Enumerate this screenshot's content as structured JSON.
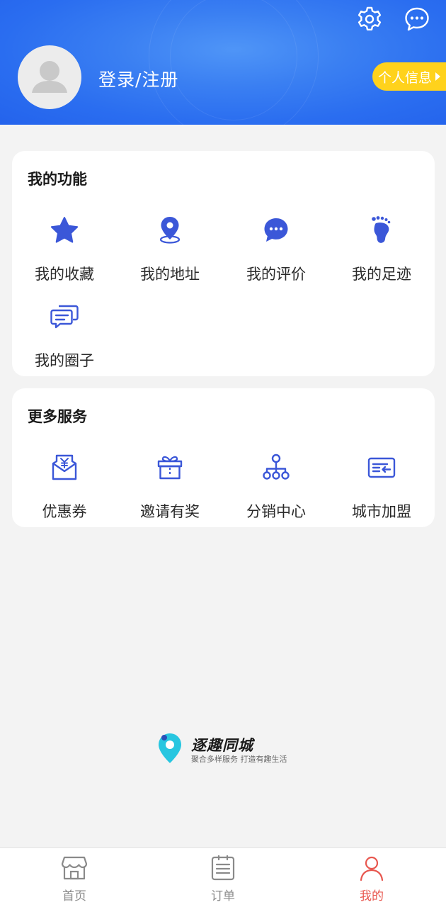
{
  "header": {
    "login_label": "登录/注册",
    "profile_button_label": "个人信息",
    "icons": [
      "settings-icon",
      "message-icon"
    ]
  },
  "my_functions": {
    "title": "我的功能",
    "items": [
      {
        "label": "我的收藏",
        "icon": "star-icon"
      },
      {
        "label": "我的地址",
        "icon": "location-pin-icon"
      },
      {
        "label": "我的评价",
        "icon": "comment-bubble-icon"
      },
      {
        "label": "我的足迹",
        "icon": "footprint-icon"
      },
      {
        "label": "我的圈子",
        "icon": "chat-stack-icon"
      }
    ]
  },
  "more_services": {
    "title": "更多服务",
    "items": [
      {
        "label": "优惠券",
        "icon": "coupon-icon"
      },
      {
        "label": "邀请有奖",
        "icon": "gift-icon"
      },
      {
        "label": "分销中心",
        "icon": "org-chart-icon"
      },
      {
        "label": "城市加盟",
        "icon": "card-join-icon"
      }
    ]
  },
  "brand": {
    "name": "逐趣同城",
    "slogan": "聚合多样服务 打造有趣生活"
  },
  "tabbar": {
    "items": [
      {
        "label": "首页",
        "icon": "store-icon",
        "active": false
      },
      {
        "label": "订单",
        "icon": "order-list-icon",
        "active": false
      },
      {
        "label": "我的",
        "icon": "user-icon",
        "active": true
      }
    ]
  },
  "colors": {
    "header_blue": "#2a6df0",
    "icon_blue": "#3b57d8",
    "badge_yellow": "#ffd21c",
    "active_red": "#e8574f"
  }
}
